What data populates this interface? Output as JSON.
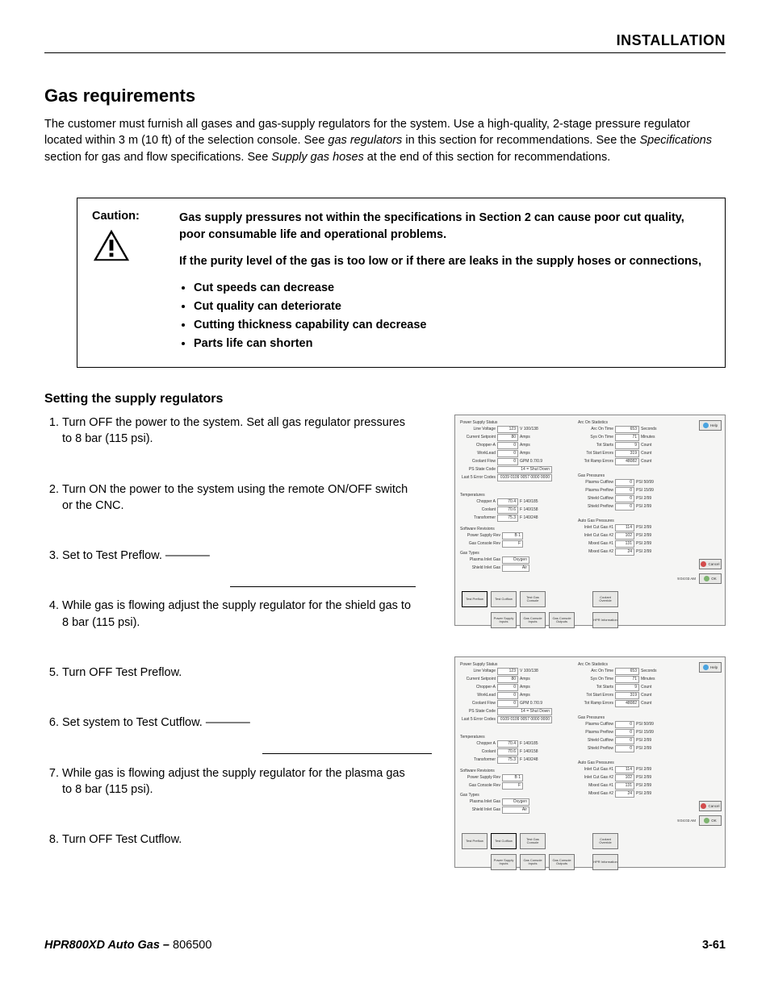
{
  "header": "INSTALLATION",
  "title": "Gas requirements",
  "intro": {
    "p1a": "The customer must furnish all gases and gas-supply regulators for the system. Use a high-quality, 2-stage pressure regulator located within 3 m (10 ft) of the selection console. See ",
    "p1i1": "gas regulators",
    "p1b": " in this section for recommendations. See the ",
    "p1i2": "Specifications",
    "p1c": " section for gas and flow specifications. See ",
    "p1i3": "Supply gas hoses",
    "p1d": " at the end of this section for recommendations."
  },
  "caution": {
    "label": "Caution:",
    "p1": "Gas supply pressures not within the specifications in Section 2 can cause poor cut quality, poor consumable life and operational problems.",
    "p2": "If the purity level of the gas is too low or if there are leaks in the supply hoses or connections,",
    "bullets": [
      "Cut speeds can decrease",
      "Cut quality can deteriorate",
      "Cutting thickness capability can decrease",
      "Parts life can shorten"
    ]
  },
  "sub": "Setting the supply regulators",
  "steps": [
    "Turn OFF the power to the system. Set all gas regulator pressures to 8 bar (115 psi).",
    "Turn ON the power to the system using the remote ON/OFF switch or the CNC.",
    "Set to Test Preflow.",
    "While gas is flowing adjust the supply regulator for the shield gas to 8 bar (115 psi).",
    "Turn OFF Test Preflow.",
    "Set system to Test Cutflow.",
    "While gas is flowing adjust the supply regulator for the plasma gas to 8 bar (115 psi).",
    "Turn OFF Test Cutflow."
  ],
  "panel": {
    "ps_status": {
      "title": "Power Supply Status",
      "rows": [
        {
          "l": "Line Voltage",
          "v": "123",
          "u": "V 100/138"
        },
        {
          "l": "Current Setpoint",
          "v": "80",
          "u": "Amps"
        },
        {
          "l": "Chopper-A",
          "v": "0",
          "u": "Amps"
        },
        {
          "l": "WorkLead",
          "v": "0",
          "u": "Amps"
        },
        {
          "l": "Coolant Flow",
          "v": "0",
          "u": "GPM 0.7/0.9"
        },
        {
          "l": "PS State Code",
          "v": "14 = Shut Down",
          "u": ""
        },
        {
          "l": "Last 5 Error Codes",
          "v": "0109 0109 0057 0000 0000",
          "u": ""
        }
      ]
    },
    "temps": {
      "title": "Temperatures",
      "rows": [
        {
          "l": "Chopper A",
          "v": "70.4",
          "u": "F 140/185"
        },
        {
          "l": "Coolant",
          "v": "70.6",
          "u": "F 140/158"
        },
        {
          "l": "Transformer",
          "v": "75.3",
          "u": "F 140/248"
        }
      ]
    },
    "sw": {
      "title": "Software Revisions",
      "rows": [
        {
          "l": "Power Supply Rev",
          "v": "B 1",
          "u": ""
        },
        {
          "l": "Gas Console Rev",
          "v": "F",
          "u": ""
        }
      ]
    },
    "gtypes": {
      "title": "Gas Types",
      "rows": [
        {
          "l": "Plasma Inlet Gas",
          "v": "Oxygen",
          "u": ""
        },
        {
          "l": "Shield Inlet Gas",
          "v": "Air",
          "u": ""
        }
      ]
    },
    "arc": {
      "title": "Arc On Statistics",
      "rows": [
        {
          "l": "Arc On Time",
          "v": "653",
          "u": "Seconds"
        },
        {
          "l": "Sys On Time",
          "v": "71",
          "u": "Minutes"
        },
        {
          "l": "Tot Starts",
          "v": "9",
          "u": "Count"
        },
        {
          "l": "Tot Start Errors",
          "v": "319",
          "u": "Count"
        },
        {
          "l": "Tot Ramp Errors",
          "v": "48082",
          "u": "Count"
        }
      ]
    },
    "gp": {
      "title": "Gas Pressures",
      "rows": [
        {
          "l": "Plasma Cutflow",
          "v": "0",
          "u": "PSI 50/99"
        },
        {
          "l": "Plasma Preflow",
          "v": "0",
          "u": "PSI 15/99"
        },
        {
          "l": "Shield Cutflow",
          "v": "0",
          "u": "PSI 2/99"
        },
        {
          "l": "Shield Preflow",
          "v": "0",
          "u": "PSI 2/99"
        }
      ]
    },
    "agp": {
      "title": "Auto Gas Pressures",
      "rows": [
        {
          "l": "Inlet Cut Gas #1",
          "v": "114",
          "u": "PSI 2/99"
        },
        {
          "l": "Inlet Cut Gas #2",
          "v": "102",
          "u": "PSI 2/99"
        },
        {
          "l": "Mixed Gas #1",
          "v": "131",
          "u": "PSI 2/99"
        },
        {
          "l": "Mixed Gas #2",
          "v": "24",
          "u": "PSI 2/99"
        }
      ]
    },
    "ts": "9:04:03 AM",
    "btns": [
      "Test Preflow",
      "Test Cutflow",
      "Test Gas Console",
      "Coolant Override",
      "Power Supply Inputs",
      "Gas Console Inputs",
      "Gas Console Outputs",
      "HPR Information"
    ],
    "side": [
      {
        "t": "Help",
        "c": "#4aa3df"
      },
      {
        "t": "Cancel",
        "c": "#d34c4c"
      },
      {
        "t": "OK",
        "c": "#7db36f"
      }
    ]
  },
  "footer": {
    "model": "HPR800XD Auto Gas – ",
    "doc": "806500",
    "page": "3-61"
  }
}
